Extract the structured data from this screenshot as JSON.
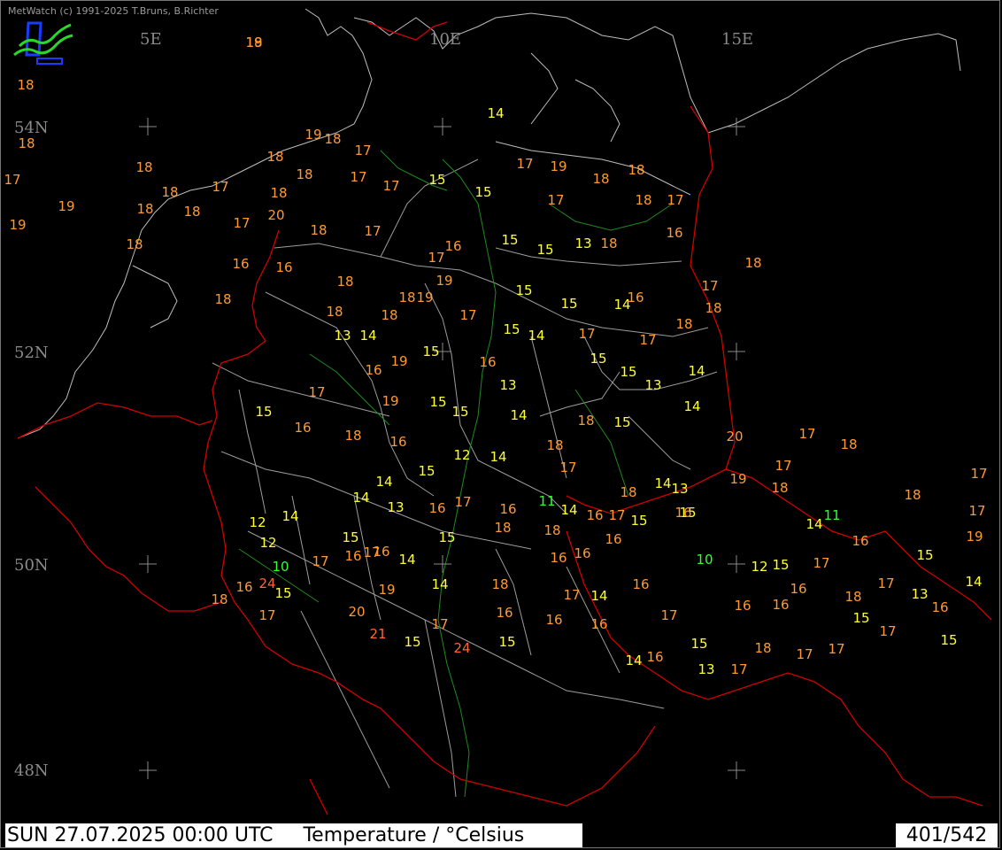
{
  "header": {
    "copyright": "MetWatch  (c) 1991-2025 T.Bruns, B.Richter"
  },
  "footer": {
    "datetime": "SUN 27.07.2025 00:00 UTC",
    "parameter": "Temperature / °Celsius",
    "frame_counter": "401/542"
  },
  "grid_labels": [
    "5E",
    "10E",
    "15E",
    "54N",
    "52N",
    "50N",
    "48N"
  ],
  "colors": {
    "background": "#000000",
    "borders": "#d00000",
    "boundaries": "#cfcfcf",
    "rivers": "#1f8a1f",
    "temp_warm": "#ff9933",
    "temp_cool": "#ffff33",
    "temp_hot": "#ff6633",
    "temp_cold": "#33ff33"
  },
  "station_temperatures": [
    "18",
    "18",
    "18",
    "17",
    "19",
    "19",
    "18",
    "18",
    "18",
    "18",
    "18",
    "17",
    "17",
    "18",
    "18",
    "17",
    "17",
    "15",
    "15",
    "14",
    "19",
    "18",
    "17",
    "18",
    "20",
    "18",
    "17",
    "16",
    "16",
    "18",
    "18",
    "18",
    "19",
    "19",
    "17",
    "16",
    "15",
    "15",
    "13",
    "18",
    "17",
    "18",
    "18",
    "18",
    "19",
    "17",
    "17",
    "15",
    "15",
    "14",
    "16",
    "16",
    "17",
    "18",
    "18",
    "18",
    "17",
    "17",
    "15",
    "15",
    "13",
    "14",
    "14",
    "15",
    "18",
    "18",
    "17",
    "14",
    "12",
    "13",
    "14",
    "14",
    "15",
    "16",
    "17",
    "15",
    "19",
    "16",
    "14",
    "13",
    "18",
    "18",
    "17",
    "15",
    "16",
    "18",
    "19",
    "15",
    "15",
    "16",
    "15",
    "14",
    "14",
    "13",
    "16",
    "17",
    "16",
    "11",
    "14",
    "16",
    "17",
    "18",
    "14",
    "13",
    "15",
    "15",
    "16",
    "18",
    "18",
    "15",
    "14",
    "16",
    "16",
    "17",
    "17",
    "15",
    "14",
    "12",
    "12",
    "10",
    "16",
    "24",
    "15",
    "17",
    "18",
    "20",
    "21",
    "19",
    "14",
    "18",
    "16",
    "17",
    "15",
    "24",
    "15",
    "16",
    "16",
    "17",
    "14",
    "16",
    "16",
    "16",
    "17",
    "15",
    "14",
    "16",
    "13",
    "17",
    "18",
    "17",
    "17",
    "15",
    "17",
    "16",
    "16",
    "16",
    "17",
    "18",
    "17",
    "13",
    "16",
    "15",
    "14",
    "15",
    "16",
    "11",
    "14",
    "15",
    "12",
    "10",
    "16",
    "17",
    "18",
    "19",
    "20",
    "17",
    "18",
    "18",
    "17",
    "17",
    "19",
    "19"
  ]
}
